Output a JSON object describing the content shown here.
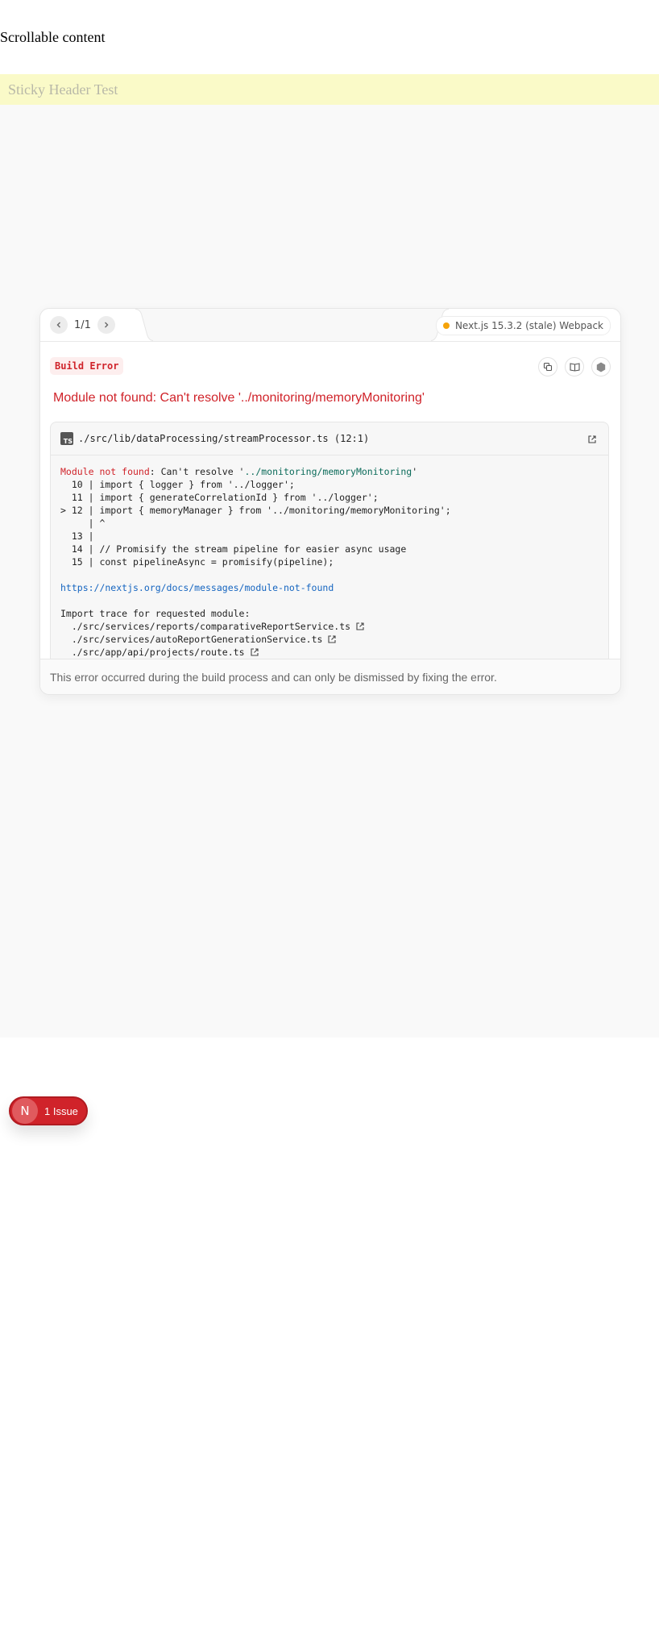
{
  "page": {
    "scroll_text": "Scrollable content",
    "sticky_header": "Sticky Header Test"
  },
  "dialog": {
    "pager": {
      "count": "1/1",
      "prev_icon": "chevron-left-icon",
      "next_icon": "chevron-right-icon"
    },
    "version": "Next.js 15.3.2 (stale) Webpack",
    "version_status_color": "#f5a30a",
    "badge": "Build Error",
    "title": "Module not found: Can't resolve '../monitoring/memoryMonitoring'",
    "toolbar": [
      "copy-icon",
      "docs-book-icon",
      "nodejs-icon"
    ],
    "codeframe": {
      "file_icon": "TS",
      "file": "./src/lib/dataProcessing/streamProcessor.ts (12:1)",
      "error_prefix": "Module not found",
      "error_rest": ": Can't resolve '",
      "error_module": "../monitoring/memoryMonitoring",
      "error_close": "'",
      "lines": [
        "  10 | import { logger } from '../logger';",
        "  11 | import { generateCorrelationId } from '../logger';",
        "> 12 | import { memoryManager } from '../monitoring/memoryMonitoring';",
        "     | ^",
        "  13 |",
        "  14 | // Promisify the stream pipeline for easier async usage",
        "  15 | const pipelineAsync = promisify(pipeline);"
      ],
      "link": "https://nextjs.org/docs/messages/module-not-found",
      "trace_title": "Import trace for requested module:",
      "trace": [
        "./src/services/reports/comparativeReportService.ts",
        "./src/services/autoReportGenerationService.ts",
        "./src/app/api/projects/route.ts"
      ]
    },
    "footer": "This error occurred during the build process and can only be dismissed by fixing the error."
  },
  "issues_pill": {
    "logo": "N",
    "label": "1 Issue"
  },
  "colors": {
    "error": "#d0232a",
    "overlay_bg": "#f9f9f9",
    "sticky_bg": "#fafac8"
  }
}
